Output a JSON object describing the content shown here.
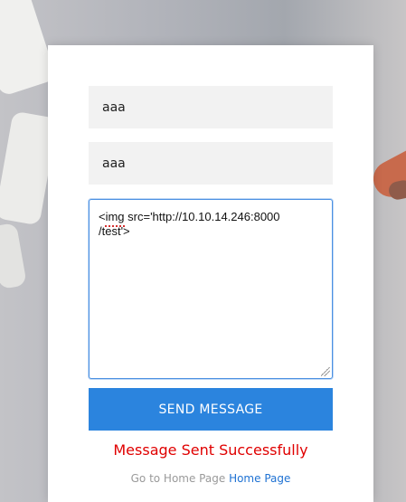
{
  "form": {
    "name_value": "aaa",
    "email_value": "aaa",
    "message_value": "<img src='http://10.10.14.246:8000\n/test'>",
    "send_button_label": "SEND MESSAGE",
    "status_message": "Message Sent Successfully",
    "footer_prefix": "Go to Home Page",
    "footer_link_label": "Home Page"
  },
  "colors": {
    "button_bg": "#2b84de",
    "status_text": "#e00000",
    "link_text": "#1f72d3",
    "input_bg": "#f2f2f2",
    "focus_border": "#4a90e2"
  },
  "icons": {
    "resize_handle": "resize-grip-icon",
    "spellcheck": "spellcheck-underline"
  }
}
